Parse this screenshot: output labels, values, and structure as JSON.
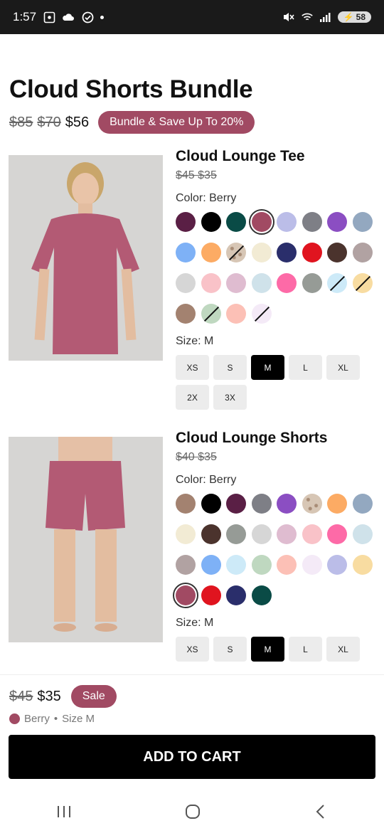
{
  "status": {
    "time": "1:57",
    "battery": "58"
  },
  "bundle": {
    "title": "Cloud Shorts Bundle",
    "price_original_1": "$85",
    "price_original_2": "$70",
    "price_now": "$56",
    "badge": "Bundle & Save Up To 20%"
  },
  "tee": {
    "name": "Cloud Lounge Tee",
    "price_strike": "$45 $35",
    "color_label": "Color: Berry",
    "size_label": "Size: M",
    "swatches": [
      {
        "color": "#5a1f45"
      },
      {
        "color": "#000000"
      },
      {
        "color": "#0a4b46"
      },
      {
        "color": "#a14a63",
        "selected": true
      },
      {
        "color": "#bbbde8"
      },
      {
        "color": "#7e7f86"
      },
      {
        "color": "#8b4ec2"
      },
      {
        "color": "#93a8c0"
      },
      {
        "color": "#7eb1f6"
      },
      {
        "color": "#fcab64"
      },
      {
        "color": "#c8b6a6",
        "slash": true
      },
      {
        "color": "#f2ebd4"
      },
      {
        "color": "#2a2e6b"
      },
      {
        "color": "#e0141f"
      },
      {
        "color": "#4b332d"
      },
      {
        "color": "#b1a2a2"
      },
      {
        "color": "#d6d6d6"
      },
      {
        "color": "#f9c2c8"
      },
      {
        "color": "#dfbcd0"
      },
      {
        "color": "#cfe2ea"
      },
      {
        "color": "#fd6aa7"
      },
      {
        "color": "#969b96"
      },
      {
        "color": "#cdeaf8",
        "slash": true
      },
      {
        "color": "#f8dca1",
        "slash": true
      },
      {
        "color": "#a38270"
      },
      {
        "color": "#bfd8c0",
        "slash": true
      },
      {
        "color": "#fcc0b6"
      },
      {
        "color": "#f4eaf7",
        "slash": true
      }
    ],
    "sizes": [
      "XS",
      "S",
      "M",
      "L",
      "XL",
      "2X",
      "3X"
    ],
    "selected_size": "M"
  },
  "shorts": {
    "name": "Cloud Lounge Shorts",
    "price_strike": "$40 $35",
    "color_label": "Color: Berry",
    "size_label": "Size: M",
    "swatches": [
      {
        "color": "#a38270"
      },
      {
        "color": "#000000"
      },
      {
        "color": "#5a1f45"
      },
      {
        "color": "#7e7f86"
      },
      {
        "color": "#8b4ec2"
      },
      {
        "color": "#c8b6a6"
      },
      {
        "color": "#fcab64"
      },
      {
        "color": "#93a8c0"
      },
      {
        "color": "#f2ebd4"
      },
      {
        "color": "#4b332d"
      },
      {
        "color": "#969b96"
      },
      {
        "color": "#d6d6d6"
      },
      {
        "color": "#dfbcd0"
      },
      {
        "color": "#f9c2c8"
      },
      {
        "color": "#fd6aa7"
      },
      {
        "color": "#cfe2ea"
      },
      {
        "color": "#b1a2a2"
      },
      {
        "color": "#7eb1f6"
      },
      {
        "color": "#cdeaf8"
      },
      {
        "color": "#bfd8c0"
      },
      {
        "color": "#fcc0b6"
      },
      {
        "color": "#f4eaf7"
      },
      {
        "color": "#bbbde8"
      },
      {
        "color": "#f8dca1"
      },
      {
        "color": "#a14a63",
        "selected": true
      },
      {
        "color": "#e0141f"
      },
      {
        "color": "#2a2e6b"
      },
      {
        "color": "#0a4b46"
      }
    ],
    "sizes": [
      "XS",
      "S",
      "M",
      "L",
      "XL"
    ],
    "selected_size": "M"
  },
  "bottom": {
    "price_original": "$45",
    "price_now": "$35",
    "sale_badge": "Sale",
    "selection_color": "Berry",
    "selection_sep": "•",
    "selection_size": "Size M",
    "add_to_cart": "ADD TO CART"
  }
}
